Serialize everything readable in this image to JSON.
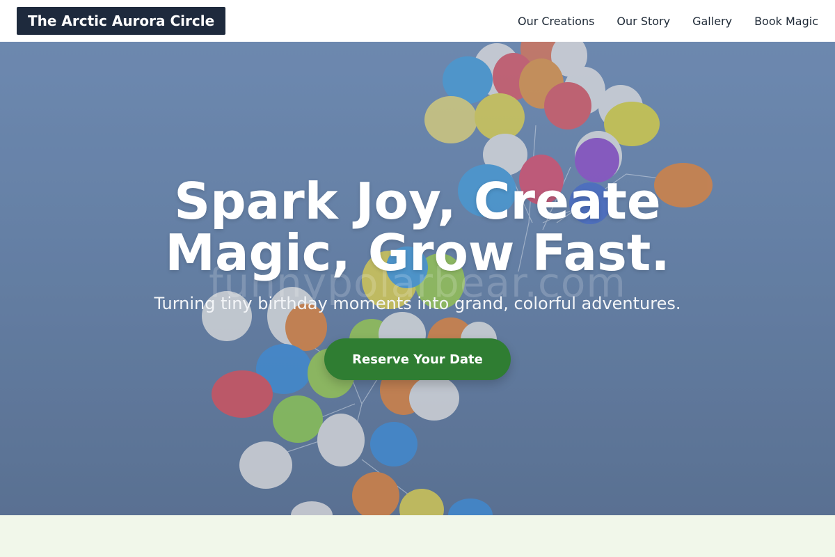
{
  "header": {
    "brand": "The Arctic Aurora Circle",
    "nav": [
      "Our Creations",
      "Our Story",
      "Gallery",
      "Book Magic"
    ]
  },
  "hero": {
    "title": "Spark Joy, Create Magic, Grow Fast.",
    "subtitle": "Turning tiny birthday moments into grand, colorful adventures.",
    "cta_label": "Reserve Your Date",
    "watermark": "funnypolarbear.com",
    "image": "balloon-bunch-sky"
  },
  "colors": {
    "brand_bg": "#1e2a3d",
    "cta": "#2f7d32",
    "sky": "#7592b9",
    "next_section": "#f1f7ea"
  }
}
